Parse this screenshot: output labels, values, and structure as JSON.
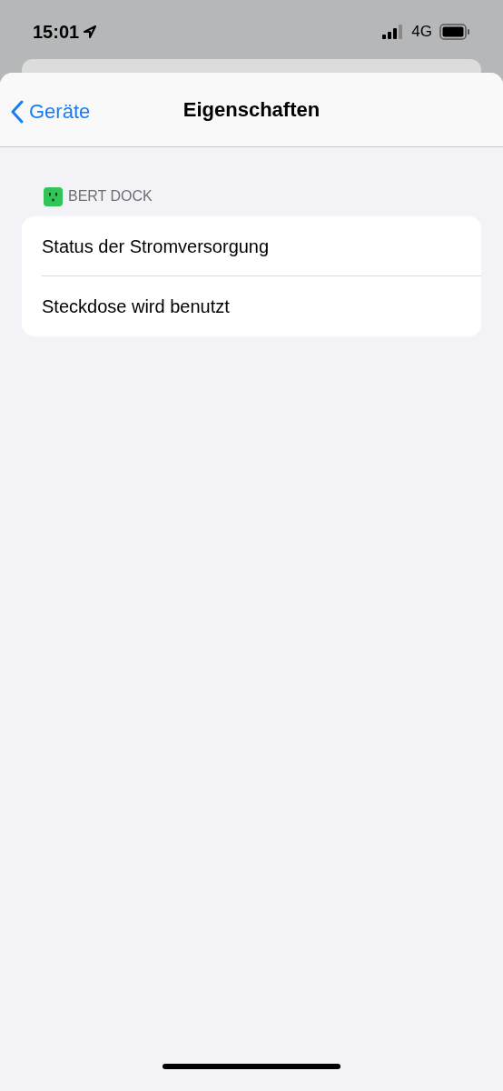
{
  "status_bar": {
    "time": "15:01",
    "network": "4G"
  },
  "nav": {
    "back": "Geräte",
    "title": "Eigenschaften"
  },
  "section": {
    "header": "BERT DOCK",
    "rows": [
      {
        "label": "Status der Stromversorgung"
      },
      {
        "label": "Steckdose wird benutzt"
      }
    ]
  }
}
